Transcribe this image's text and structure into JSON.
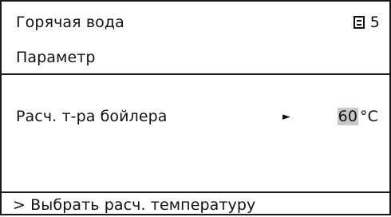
{
  "header": {
    "title": "Горячая вода",
    "page_icon": "page-list-icon",
    "page_number": "5"
  },
  "subheader": {
    "label": "Параметр"
  },
  "parameter": {
    "label": "Расч. т-ра бойлера",
    "arrow": "►",
    "value": "60",
    "unit": "°C"
  },
  "footer": {
    "hint": "> Выбрать расч. температуру"
  },
  "colors": {
    "border": "#1a1a1a",
    "value_highlight": "#c8c8c8",
    "background": "#ffffff"
  }
}
